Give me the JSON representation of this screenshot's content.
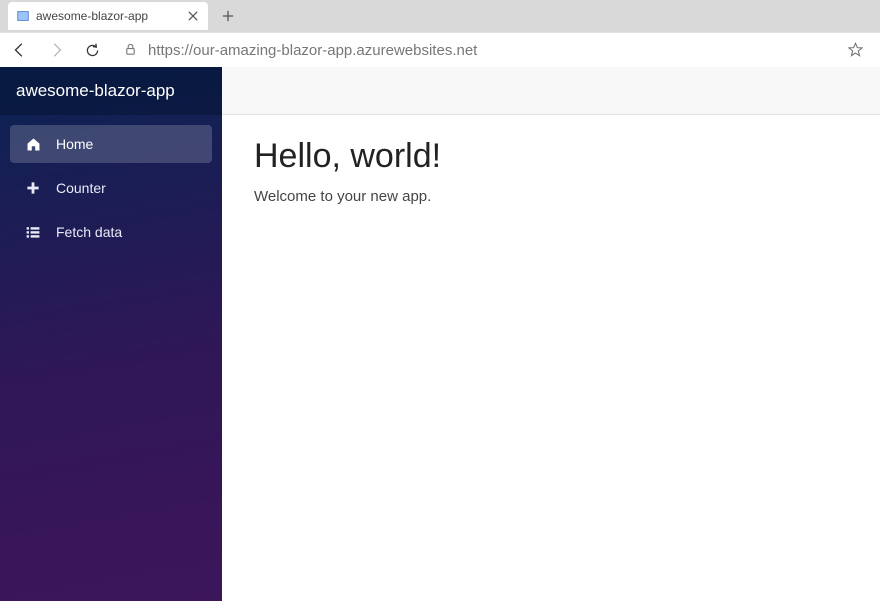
{
  "browser": {
    "tab_title": "awesome-blazor-app",
    "url": "https://our-amazing-blazor-app.azurewebsites.net"
  },
  "sidebar": {
    "brand": "awesome-blazor-app",
    "items": [
      {
        "label": "Home",
        "active": true
      },
      {
        "label": "Counter",
        "active": false
      },
      {
        "label": "Fetch data",
        "active": false
      }
    ]
  },
  "page": {
    "heading": "Hello, world!",
    "welcome": "Welcome to your new app."
  }
}
